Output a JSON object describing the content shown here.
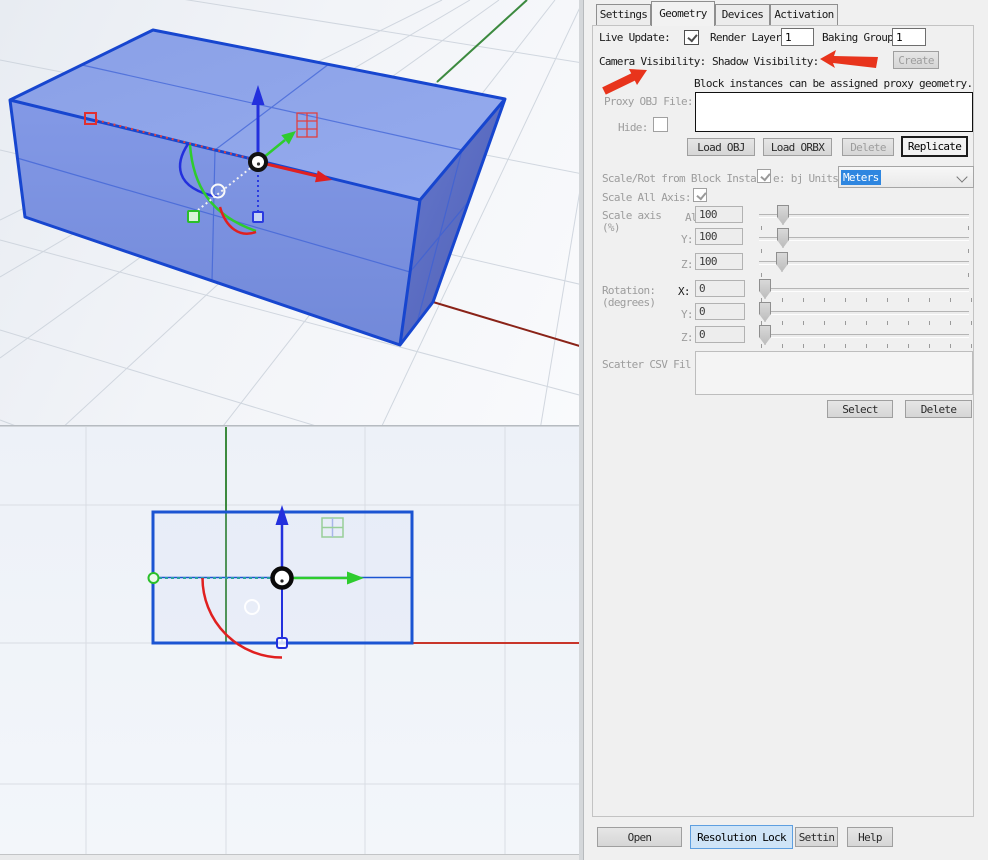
{
  "panel": {
    "tabs": [
      {
        "label": "Settings"
      },
      {
        "label": "Geometry"
      },
      {
        "label": "Devices"
      },
      {
        "label": "Activation"
      }
    ],
    "top": {
      "live_update": "Live Update:",
      "render_layer": "Render Layer",
      "render_layer_value": "1",
      "baking_group": "Baking Group:",
      "baking_group_value": "1",
      "camera_visibility": "Camera Visibility:",
      "shadow_visibility": "Shadow Visibility:",
      "create": "Create",
      "note": "Block instances can be assigned proxy geometry."
    },
    "proxy": {
      "label": "Proxy OBJ File:",
      "hide": "Hide:",
      "load_obj": "Load OBJ",
      "load_orbx": "Load ORBX",
      "delete": "Delete",
      "replicate": "Replicate"
    },
    "block": {
      "scale_rot": "Scale/Rot from Block Insta",
      "scale_rot2": "e: bj Units",
      "units_value": "Meters",
      "scale_all": "Scale All Axis:",
      "scale_axis": "Scale axis",
      "pct": "(%)",
      "a_label": "Al",
      "y_label": "Y:",
      "z_label": "Z:",
      "a_value": "100",
      "y_value": "100",
      "z_value": "100"
    },
    "rotation": {
      "label": "Rotation:",
      "unit": "(degrees)",
      "x_label": "X:",
      "y_label": "Y:",
      "z_label": "Z:",
      "x_value": "0",
      "y_value": "0",
      "z_value": "0"
    },
    "scatter": {
      "label": "Scatter CSV Fil",
      "select": "Select",
      "delete": "Delete"
    },
    "footer": {
      "open": "Open",
      "resolution_lock": "Resolution Lock",
      "settings": "Settin",
      "help": "Help"
    }
  },
  "scene": {
    "selection_blue": "#1b54d2",
    "box_fill_top": "#8ca3e9",
    "box_fill_left": "#7e97e4",
    "box_fill_right": "#5f74c9",
    "axis_x_color": "#8a2318",
    "axis_y_color": "#3c8a3f",
    "gizmo_x_color": "#e02020",
    "gizmo_y_color": "#2ecc2e",
    "gizmo_z_color": "#2330dd",
    "annotation_red": "#e8341c",
    "units_highlight": "#2e86e0"
  }
}
